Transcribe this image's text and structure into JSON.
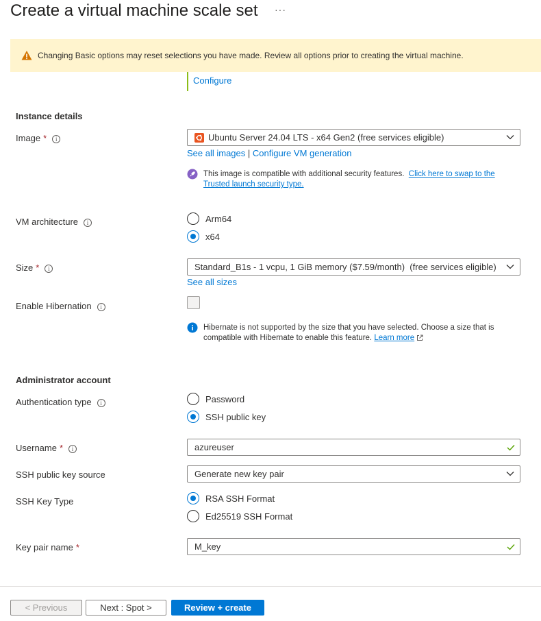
{
  "page": {
    "title": "Create a virtual machine scale set",
    "more_label": "···"
  },
  "warning": {
    "text": "Changing Basic options may reset selections you have made. Review all options prior to creating the virtual machine."
  },
  "configure_link": "Configure",
  "instance_details": {
    "heading": "Instance details",
    "image": {
      "label": "Image",
      "required": "*",
      "value": "Ubuntu Server 24.04 LTS - x64 Gen2 (free services eligible)",
      "link_all_images": "See all images",
      "separator": "|",
      "link_configure_gen": "Configure VM generation",
      "note_text": "This image is compatible with additional security features.",
      "note_link_1": "Click here to swap to the",
      "note_link_2": "Trusted launch security type."
    },
    "vm_architecture": {
      "label": "VM architecture",
      "options": [
        "Arm64",
        "x64"
      ],
      "selected": "x64"
    },
    "size": {
      "label": "Size",
      "required": "*",
      "value": "Standard_B1s - 1 vcpu, 1 GiB memory ($7.59/month)  (free services eligible)",
      "link_all_sizes": "See all sizes"
    },
    "hibernation": {
      "label": "Enable Hibernation",
      "checked": false,
      "note_line1": "Hibernate is not supported by the size that you have selected. Choose a size that is",
      "note_line2": "compatible with Hibernate to enable this feature.",
      "learn_more": "Learn more"
    }
  },
  "admin_account": {
    "heading": "Administrator account",
    "auth_type": {
      "label": "Authentication type",
      "options": [
        "Password",
        "SSH public key"
      ],
      "selected": "SSH public key"
    },
    "username": {
      "label": "Username",
      "required": "*",
      "value": "azureuser"
    },
    "ssh_source": {
      "label": "SSH public key source",
      "value": "Generate new key pair"
    },
    "ssh_key_type": {
      "label": "SSH Key Type",
      "options": [
        "RSA SSH Format",
        "Ed25519 SSH Format"
      ],
      "selected": "RSA SSH Format"
    },
    "key_pair_name": {
      "label": "Key pair name",
      "required": "*",
      "value": "M_key"
    }
  },
  "footer": {
    "previous": "< Previous",
    "next": "Next : Spot >",
    "review": "Review + create"
  },
  "colors": {
    "accent": "#0078d4",
    "warning_bg": "#fff4ce",
    "valid": "#57a300",
    "required": "#a4262c"
  }
}
